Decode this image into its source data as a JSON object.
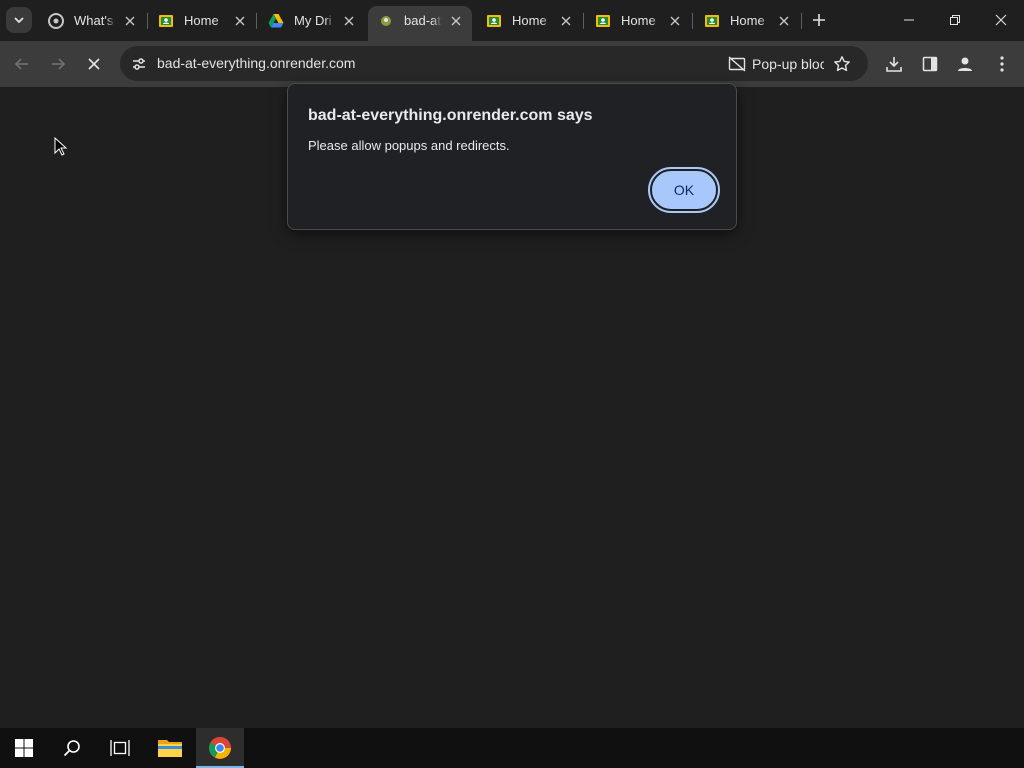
{
  "tabs": [
    {
      "title": "What's",
      "favicon": "chrome-icon",
      "active": false
    },
    {
      "title": "Home",
      "favicon": "classroom-icon",
      "active": false
    },
    {
      "title": "My Dri",
      "favicon": "drive-icon",
      "active": false
    },
    {
      "title": "bad-at",
      "favicon": "site-icon",
      "active": true
    },
    {
      "title": "Home",
      "favicon": "classroom-icon",
      "active": false
    },
    {
      "title": "Home",
      "favicon": "classroom-icon",
      "active": false
    },
    {
      "title": "Home",
      "favicon": "classroom-icon",
      "active": false
    }
  ],
  "omnibox": {
    "url": "bad-at-everything.onrender.com",
    "popup_blocked_label": "Pop-up blocked"
  },
  "dialog": {
    "title": "bad-at-everything.onrender.com says",
    "message": "Please allow popups and redirects.",
    "ok_label": "OK"
  },
  "colors": {
    "background": "#1f1f1f",
    "toolbar": "#3c3c3c",
    "accent": "#a8c7fa"
  }
}
